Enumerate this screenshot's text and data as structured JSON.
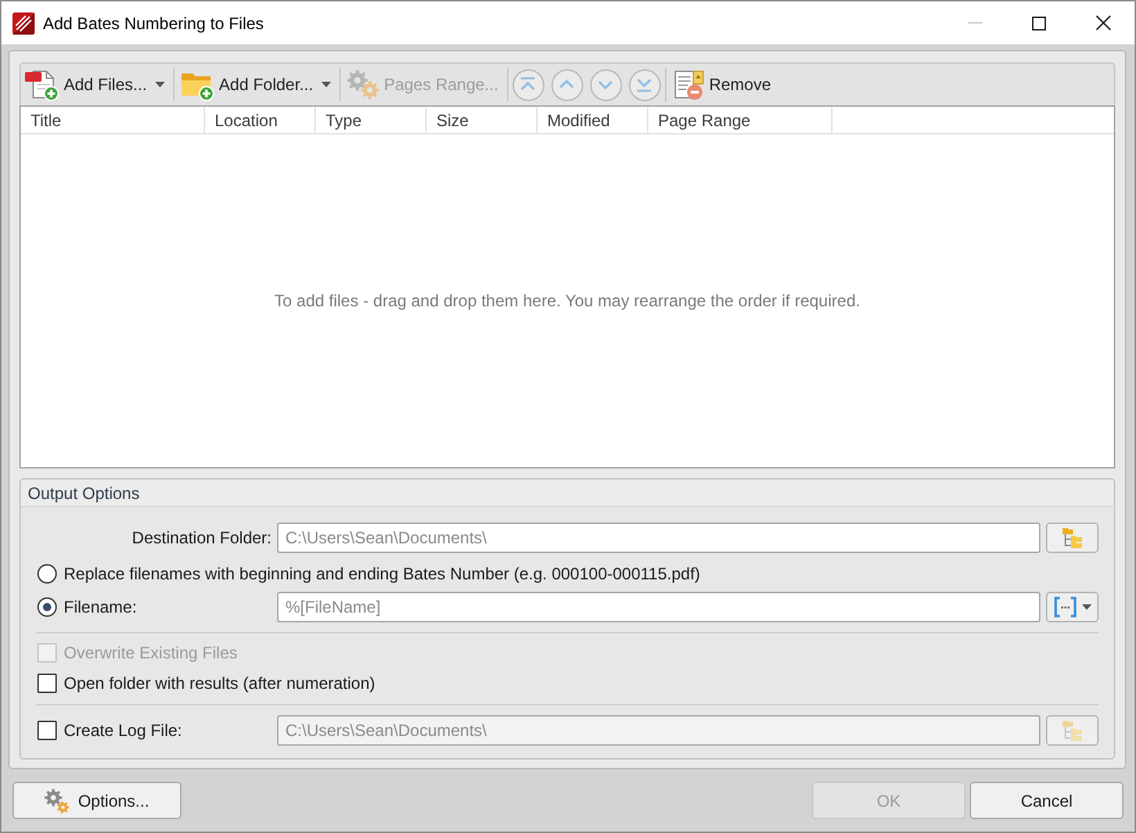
{
  "window": {
    "title": "Add Bates Numbering to Files",
    "controls": [
      {
        "disabled": true
      },
      {
        "disabled": false
      },
      {
        "disabled": false
      }
    ]
  },
  "toolbar": {
    "groups": [
      [
        {
          "kind": "menu-button",
          "label": "Add Files...",
          "disabled": false
        }
      ],
      [
        {
          "kind": "menu-button",
          "label": "Add Folder...",
          "disabled": false
        }
      ],
      [
        {
          "kind": "button",
          "label": "Pages Range...",
          "disabled": true
        }
      ],
      [
        {
          "kind": "round",
          "disabled": true
        },
        {
          "kind": "round",
          "disabled": true
        },
        {
          "kind": "round",
          "disabled": true
        },
        {
          "kind": "round",
          "disabled": true
        }
      ],
      [
        {
          "kind": "button",
          "label": "Remove",
          "disabled": false
        }
      ]
    ]
  },
  "file_list": {
    "columns": [
      "Title",
      "Location",
      "Type",
      "Size",
      "Modified",
      "Page Range"
    ],
    "empty_message": "To add files - drag and drop them here. You may rearrange the order if required."
  },
  "output_options": {
    "title": "Output Options",
    "destination_folder": {
      "label": "Destination Folder:",
      "value": "C:\\Users\\Sean\\Documents\\"
    },
    "naming": [
      {
        "label": "Replace filenames with beginning and ending Bates Number (e.g. 000100-000115.pdf)",
        "selected": false
      },
      {
        "label": "Filename:",
        "selected": true,
        "value": "%[FileName]"
      }
    ],
    "checkboxes": [
      {
        "label": "Overwrite Existing Files",
        "checked": false,
        "disabled": true
      },
      {
        "label": "Open folder with results (after numeration)",
        "checked": false,
        "disabled": false
      }
    ],
    "log_file": {
      "label": "Create Log File:",
      "checked": false,
      "value": "C:\\Users\\Sean\\Documents\\",
      "field_disabled": true
    }
  },
  "buttons": {
    "left": [
      {
        "kind": "icon-button",
        "label": "Options...",
        "disabled": false
      }
    ],
    "right": [
      {
        "kind": "button",
        "label": "OK",
        "disabled": true
      },
      {
        "kind": "button",
        "label": "Cancel",
        "disabled": false
      }
    ]
  }
}
